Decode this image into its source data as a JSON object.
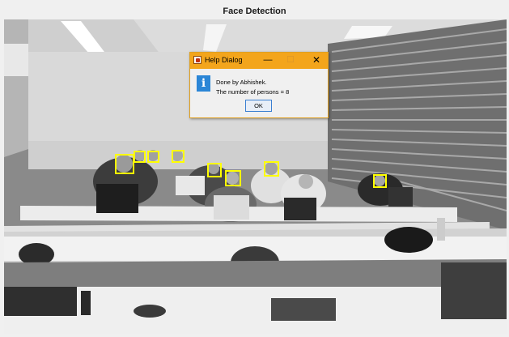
{
  "figure": {
    "title": "Face Detection"
  },
  "dialog": {
    "title": "Help Dialog",
    "minimize_glyph": "—",
    "maximize_glyph": "☐",
    "close_glyph": "✕",
    "info_glyph": "i",
    "message_line1": "Done by  Abhishek.",
    "message_line2": "The number of persons = 8",
    "ok_label": "OK"
  },
  "colors": {
    "face_box": "#ffff00",
    "dialog_titlebar": "#f3a51c",
    "info_icon": "#2b86d6",
    "ok_border": "#3a7fd1"
  },
  "detected_faces_count": 8
}
